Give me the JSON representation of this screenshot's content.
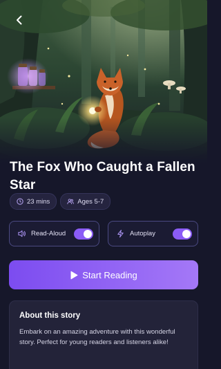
{
  "nav": {
    "back_icon": "chevron-left-icon"
  },
  "hero": {
    "scene": "fox-holding-glowing-star-in-forest",
    "colors": {
      "forest": "#2c4a32",
      "glow": "#f6d77a",
      "fox": "#c9622a",
      "jars": "#c08cf0"
    }
  },
  "story": {
    "title": "The Fox Who Caught a Fallen Star",
    "duration": "23 mins",
    "duration_icon": "clock-icon",
    "ages": "Ages 5-7",
    "ages_icon": "users-icon"
  },
  "settings": {
    "read_aloud": {
      "label": "Read-Aloud",
      "icon": "speaker-icon",
      "enabled": true
    },
    "autoplay": {
      "label": "Autoplay",
      "icon": "lightning-icon",
      "enabled": true
    }
  },
  "actions": {
    "start_label": "Start Reading",
    "start_icon": "play-icon"
  },
  "about": {
    "heading": "About this story",
    "body": "Embark on an amazing adventure with this wonderful story. Perfect for young readers and listeners alike!"
  },
  "colors": {
    "background": "#16172a",
    "accent": "#8b5cf6",
    "accent_light": "#a478f7",
    "card": "#232339"
  }
}
